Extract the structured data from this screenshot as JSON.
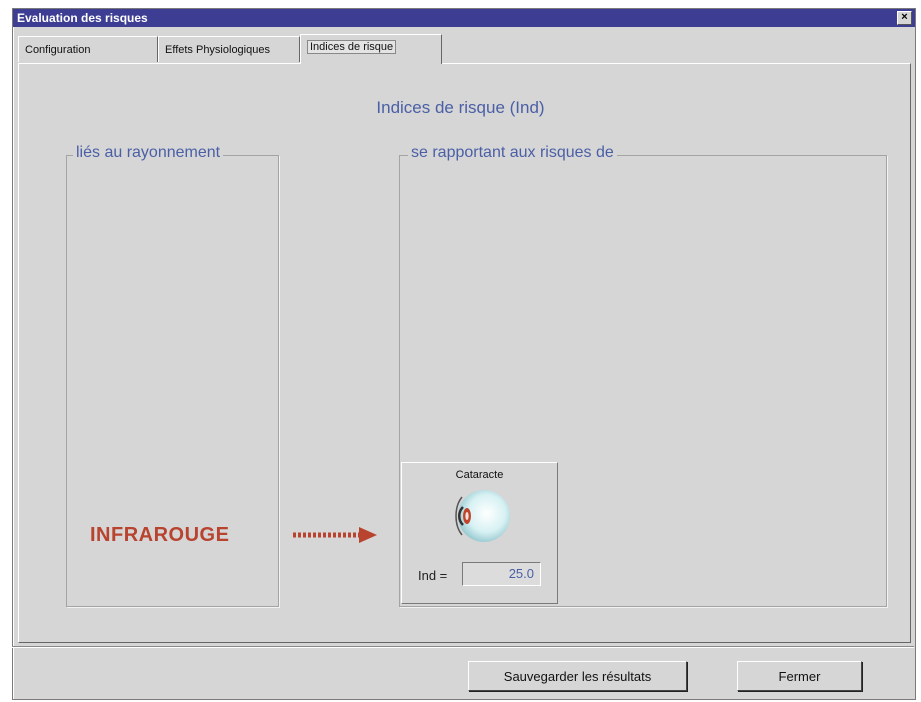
{
  "window": {
    "title": "Evaluation des risques",
    "close_glyph": "×"
  },
  "tabs": [
    {
      "label": "Configuration",
      "active": false
    },
    {
      "label": "Effets Physiologiques",
      "active": false
    },
    {
      "label": "Indices de risque",
      "active": true
    }
  ],
  "panel": {
    "title": "Indices de risque (Ind)",
    "left_group": {
      "legend": "liés au rayonnement"
    },
    "right_group": {
      "legend": "se rapportant aux risques de"
    },
    "radiation_type": "INFRAROUGE",
    "risk_item": {
      "title": "Cataracte",
      "icon": "eye-icon",
      "ind_label": "Ind =",
      "ind_value": "25.0"
    }
  },
  "buttons": {
    "save": "Sauvegarder les résultats",
    "close": "Fermer"
  },
  "colors": {
    "title_bar": "#3d3d94",
    "accent_text": "#4a5fa6",
    "infrared_red": "#b8432f",
    "face": "#d6d6d6"
  }
}
